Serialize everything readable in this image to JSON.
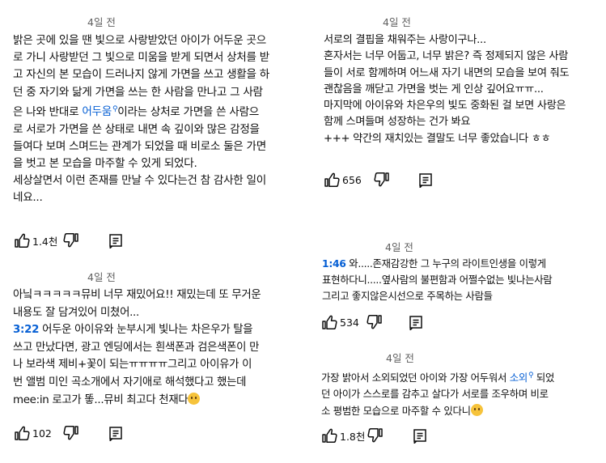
{
  "comments": [
    {
      "time": "4일 전",
      "lines": [
        "밝은 곳에 있을 땐 빛으로 사랑받았던 아이가 어두운 곳으",
        "로 가니 사랑받던 그 빛으로 미움을 받게 되면서 상처를 받",
        "고 자신의 본 모습이 드러나지 않게 가면을 쓰고 생활을 하",
        "던 중 자기와 닮게 가면을 쓰는 한 사람을 만나고 그 사람",
        "은 나와 반대로 ",
        "이라는 상처로 가면을 쓴 사람으",
        "로 서로가 가면을 쓴 상태로 내면 속 깊이와 많은 감정을",
        "들여다 보며 스며드는 관계가 되었을 때 비로소 둘은 가면",
        "을 벗고 본 모습을 마주할 수 있게 되었다.",
        "세상살면서 이런 존재를 만날 수 있다는건 참 감사한 일이",
        "네요..."
      ],
      "search_link": "어두움",
      "likes": "1.4천"
    },
    {
      "time": "4일 전",
      "lines": [
        "아닠ㅋㅋㅋㅋㅋ뮤비 너무 재밌어요!! 재밌는데 또 무거운",
        "내용도 잘 담겨있어 미쳤어...",
        " 어두운 아이유와 눈부시게 빛나는 차은우가 탈을",
        "쓰고 만났다면, 광고 엔딩에서는 흰색폰과 검은색폰이 만",
        "나 보라색 제비+꽃이 되는ㅠㅠㅠㅠ그리고 아이유가 이",
        "번 앨범 미인 곡소개에서 자기애로 해석했다고 했는데",
        "mee:in 로고가 똫...뮤비 최고다 천재다"
      ],
      "timestamp": "3:22",
      "likes": "102"
    },
    {
      "time": "4일 전",
      "lines": [
        "서로의 결핍을 채워주는 사랑이구나...",
        "혼자서는 너무 어둡고, 너무 밝은? 즉 정제되지 않은 사람",
        "들이 서로 함께하며 어느새 자기 내면의 모습을 보여 줘도",
        "괜찮음을 깨닫고 가면을 벗는 게 인상 깊어요ㅠㅠ...",
        "마지막에 아이유와 차은우의 빛도 중화된 걸 보면 사랑은",
        "함께 스며들며 성장하는 건가 봐요",
        "+++ 약간의 재치있는 결말도 너무 좋았습니다 ㅎㅎ"
      ],
      "likes": "656"
    },
    {
      "time": "4일 전",
      "lines": [
        " 와.....존재감강한 그 누구의 라이트인생을 이렇게",
        "표현하다니.....옆사람의 불편함과 어쩔수없는 빛나는사람",
        "그리고 좋지않은시선으로 주목하는 사람들"
      ],
      "timestamp": "1:46",
      "likes": "534"
    },
    {
      "time": "4일 전",
      "lines": [
        "가장 밝아서 소외되었던 아이와 가장 어두워서 ",
        " 되었",
        "던 아이가 스스로를 감추고 살다가 서로를 조우하며 비로",
        "소 평범한 모습으로 마주할 수 있다니"
      ],
      "search_link": "소외",
      "likes": "1.8천"
    }
  ],
  "icons": {
    "like": "thumbs-up-icon",
    "dislike": "thumbs-down-icon",
    "reply": "reply-icon",
    "search": "search-icon",
    "emoji_surprised": "surprised-face-emoji",
    "emoji_pleading": "pleading-face-emoji"
  },
  "colors": {
    "link": "#065fd4",
    "meta": "#606060",
    "text": "#0f0f0f"
  }
}
